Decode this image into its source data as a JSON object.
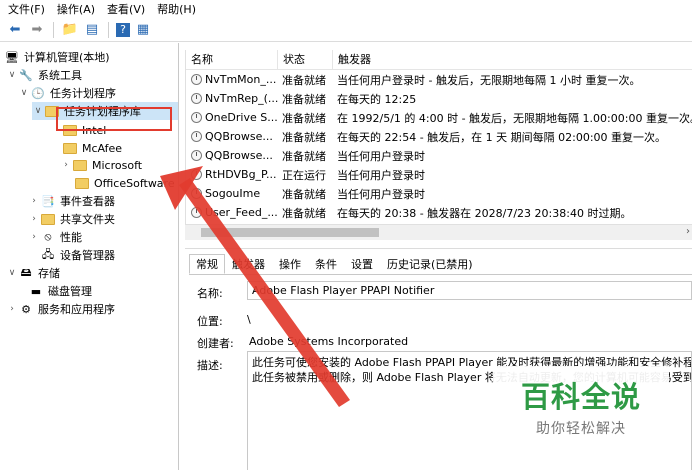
{
  "menu": [
    "文件(F)",
    "操作(A)",
    "查看(V)",
    "帮助(H)"
  ],
  "tree": {
    "root": "计算机管理(本地)",
    "system_tools": "系统工具",
    "task_scheduler": "任务计划程序",
    "task_library": "任务计划程序库",
    "folders": [
      "Intel",
      "McAfee",
      "Microsoft",
      "OfficeSoftware"
    ],
    "event_viewer": "事件查看器",
    "shared_folders": "共享文件夹",
    "performance": "性能",
    "device_manager": "设备管理器",
    "storage": "存储",
    "disk_management": "磁盘管理",
    "services_apps": "服务和应用程序"
  },
  "list": {
    "headers": [
      "名称",
      "状态",
      "触发器"
    ],
    "rows": [
      {
        "name": "NvTmMon_...",
        "status": "准备就绪",
        "trigger": "当任何用户登录时 - 触发后，无限期地每隔 1 小时 重复一次。"
      },
      {
        "name": "NvTmRep_(...",
        "status": "准备就绪",
        "trigger": "在每天的 12:25"
      },
      {
        "name": "OneDrive S...",
        "status": "准备就绪",
        "trigger": "在 1992/5/1 的 4:00 时 - 触发后，无限期地每隔 1.00:00:00 重复一次。"
      },
      {
        "name": "QQBrowse...",
        "status": "准备就绪",
        "trigger": "在每天的 22:54 - 触发后，在 1 天 期间每隔 02:00:00 重复一次。"
      },
      {
        "name": "QQBrowse...",
        "status": "准备就绪",
        "trigger": "当任何用户登录时"
      },
      {
        "name": "RtHDVBg_P...",
        "status": "正在运行",
        "trigger": "当任何用户登录时"
      },
      {
        "name": "SogouIme",
        "status": "准备就绪",
        "trigger": "当任何用户登录时"
      },
      {
        "name": "User_Feed_...",
        "status": "准备就绪",
        "trigger": "在每天的 20:38 - 触发器在 2028/7/23 20:38:40 时过期。"
      },
      {
        "name": "",
        "status": "",
        "trigger": ""
      }
    ]
  },
  "details": {
    "tabs": [
      "常规",
      "触发器",
      "操作",
      "条件",
      "设置",
      "历史记录(已禁用)"
    ],
    "name_label": "名称:",
    "name_value": "Adobe Flash Player PPAPI Notifier",
    "location_label": "位置:",
    "location_value": "\\",
    "author_label": "创建者:",
    "author_value": "Adobe Systems Incorporated",
    "desc_label": "描述:",
    "desc_line1": "此任务可使您安装的 Adobe Flash PPAPI Player 能及时获得最新的增强功能和安全修补程序",
    "desc_line2": "此任务被禁用或删除，则 Adobe Flash Player 将无法自动更新，您的计算机可能容易受到攻击。您的"
  },
  "watermark": {
    "title": "百科全说",
    "subtitle": "助你轻松解决"
  },
  "colors": {
    "highlight": "#e23b2e",
    "watermark": "#2e9a45"
  }
}
